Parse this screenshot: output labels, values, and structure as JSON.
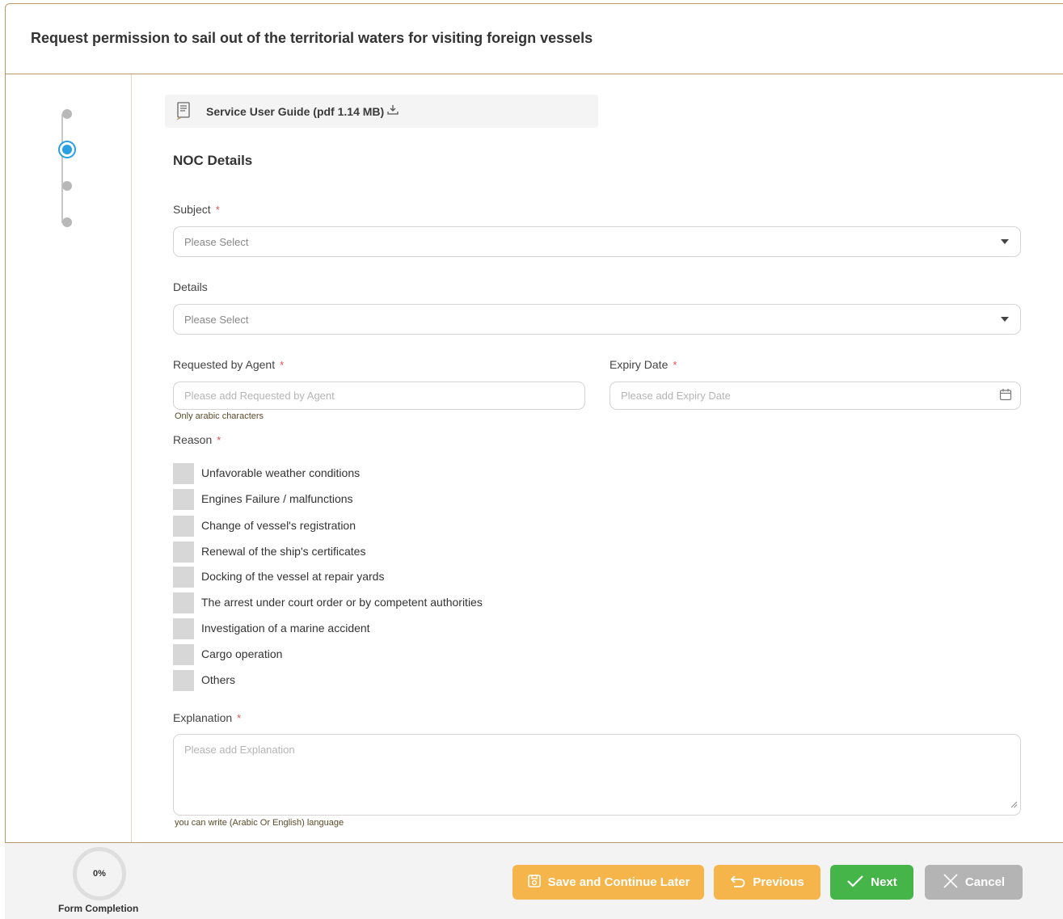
{
  "page": {
    "title": "Request permission to sail out of the territorial waters for visiting foreign vessels"
  },
  "guide": {
    "label": "Service User Guide (pdf 1.14 MB)",
    "icon": "document-icon",
    "download_icon": "download-icon"
  },
  "section": {
    "title": "NOC Details"
  },
  "fields": {
    "subject": {
      "label": "Subject",
      "required": "*",
      "placeholder": "Please Select"
    },
    "details": {
      "label": "Details",
      "placeholder": "Please Select"
    },
    "agent": {
      "label": "Requested by Agent",
      "required": "*",
      "placeholder": "Please add Requested by Agent",
      "hint": "Only arabic characters"
    },
    "expiry": {
      "label": "Expiry Date",
      "required": "*",
      "placeholder": "Please add Expiry Date"
    },
    "reason": {
      "label": "Reason",
      "required": "*",
      "options": [
        "Unfavorable weather conditions",
        "Engines Failure / malfunctions",
        "Change of vessel's registration",
        "Renewal of the ship's certificates",
        "Docking of the vessel at repair yards",
        "The arrest under court order or by competent authorities",
        "Investigation of a marine accident",
        "Cargo operation",
        "Others"
      ]
    },
    "explanation": {
      "label": "Explanation",
      "required": "*",
      "placeholder": "Please add Explanation",
      "hint": "you can write (Arabic Or English) language"
    }
  },
  "stepper": {
    "total_steps": 4,
    "active_step": 2,
    "accent": "#2ba0e0"
  },
  "footer": {
    "completion_percent": "0%",
    "completion_label": "Form Completion",
    "buttons": {
      "save": "Save and Continue Later",
      "previous": "Previous",
      "next": "Next",
      "cancel": "Cancel"
    }
  },
  "colors": {
    "border_gold": "#b69a6a",
    "save": "#f5b54a",
    "next": "#45b549",
    "cancel": "#b4b4b4",
    "required": "#d9534f"
  }
}
